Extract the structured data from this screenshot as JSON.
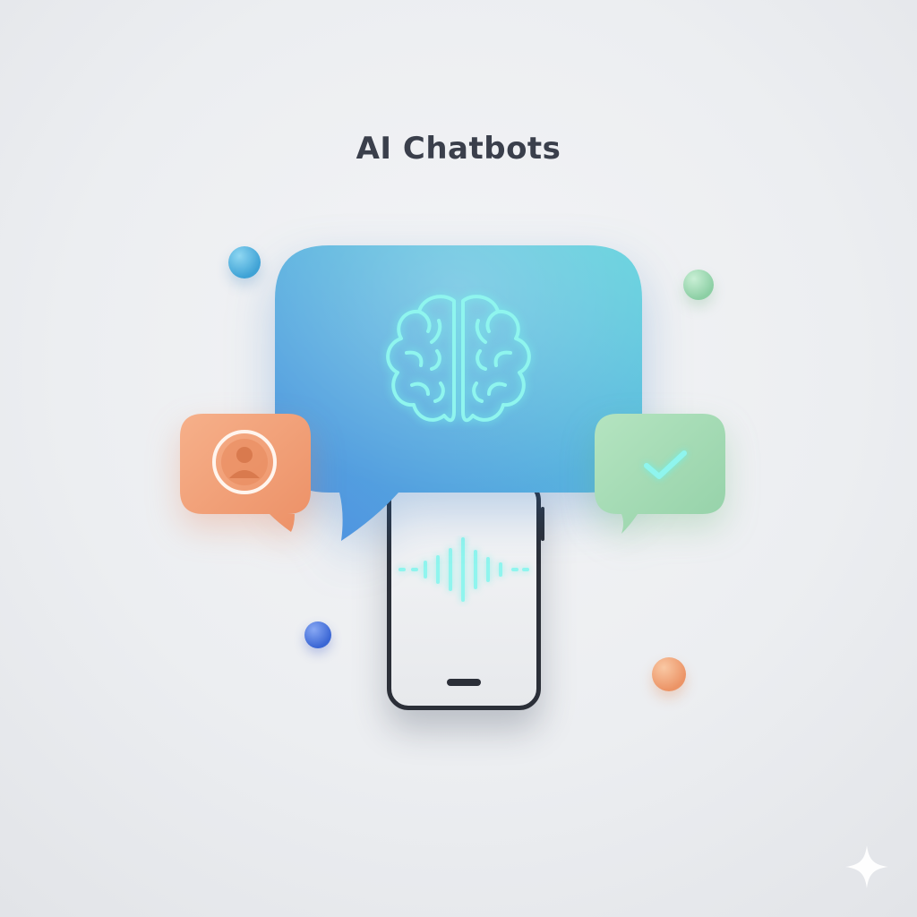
{
  "header": {
    "title": "AI Chatbots"
  },
  "illustration": {
    "main_bubble": {
      "icon": "brain-icon",
      "color_start": "#4e8fe0",
      "color_end": "#62d2dd"
    },
    "user_bubble": {
      "icon": "user-avatar-icon",
      "color": "#f0a077"
    },
    "confirm_bubble": {
      "icon": "checkmark-icon",
      "color": "#a6dcb4"
    },
    "phone": {
      "icon": "audio-waveform-icon",
      "frame_color": "#2b2f38"
    },
    "decor_orbs": [
      "#3fa3d6",
      "#8ccfa4",
      "#3a66d4",
      "#ec9466"
    ],
    "glow_color": "#8ff5ee"
  },
  "corner_mark": {
    "icon": "sparkle-icon"
  }
}
